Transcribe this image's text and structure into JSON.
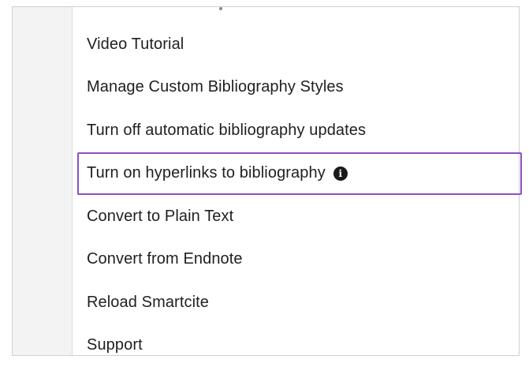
{
  "menu": {
    "items": [
      {
        "label": "Video Tutorial"
      },
      {
        "label": "Manage Custom Bibliography Styles"
      },
      {
        "label": "Turn off automatic bibliography updates"
      },
      {
        "label": "Turn on hyperlinks to bibliography",
        "has_info_icon": true,
        "highlighted": true
      },
      {
        "label": "Convert to Plain Text"
      },
      {
        "label": "Convert from Endnote"
      },
      {
        "label": "Reload Smartcite"
      },
      {
        "label": "Support"
      }
    ],
    "info_icon_glyph": "i"
  },
  "colors": {
    "highlight_border": "#8e4fbf",
    "text": "#1f1f1f",
    "icon_bg": "#1a1a1a"
  }
}
